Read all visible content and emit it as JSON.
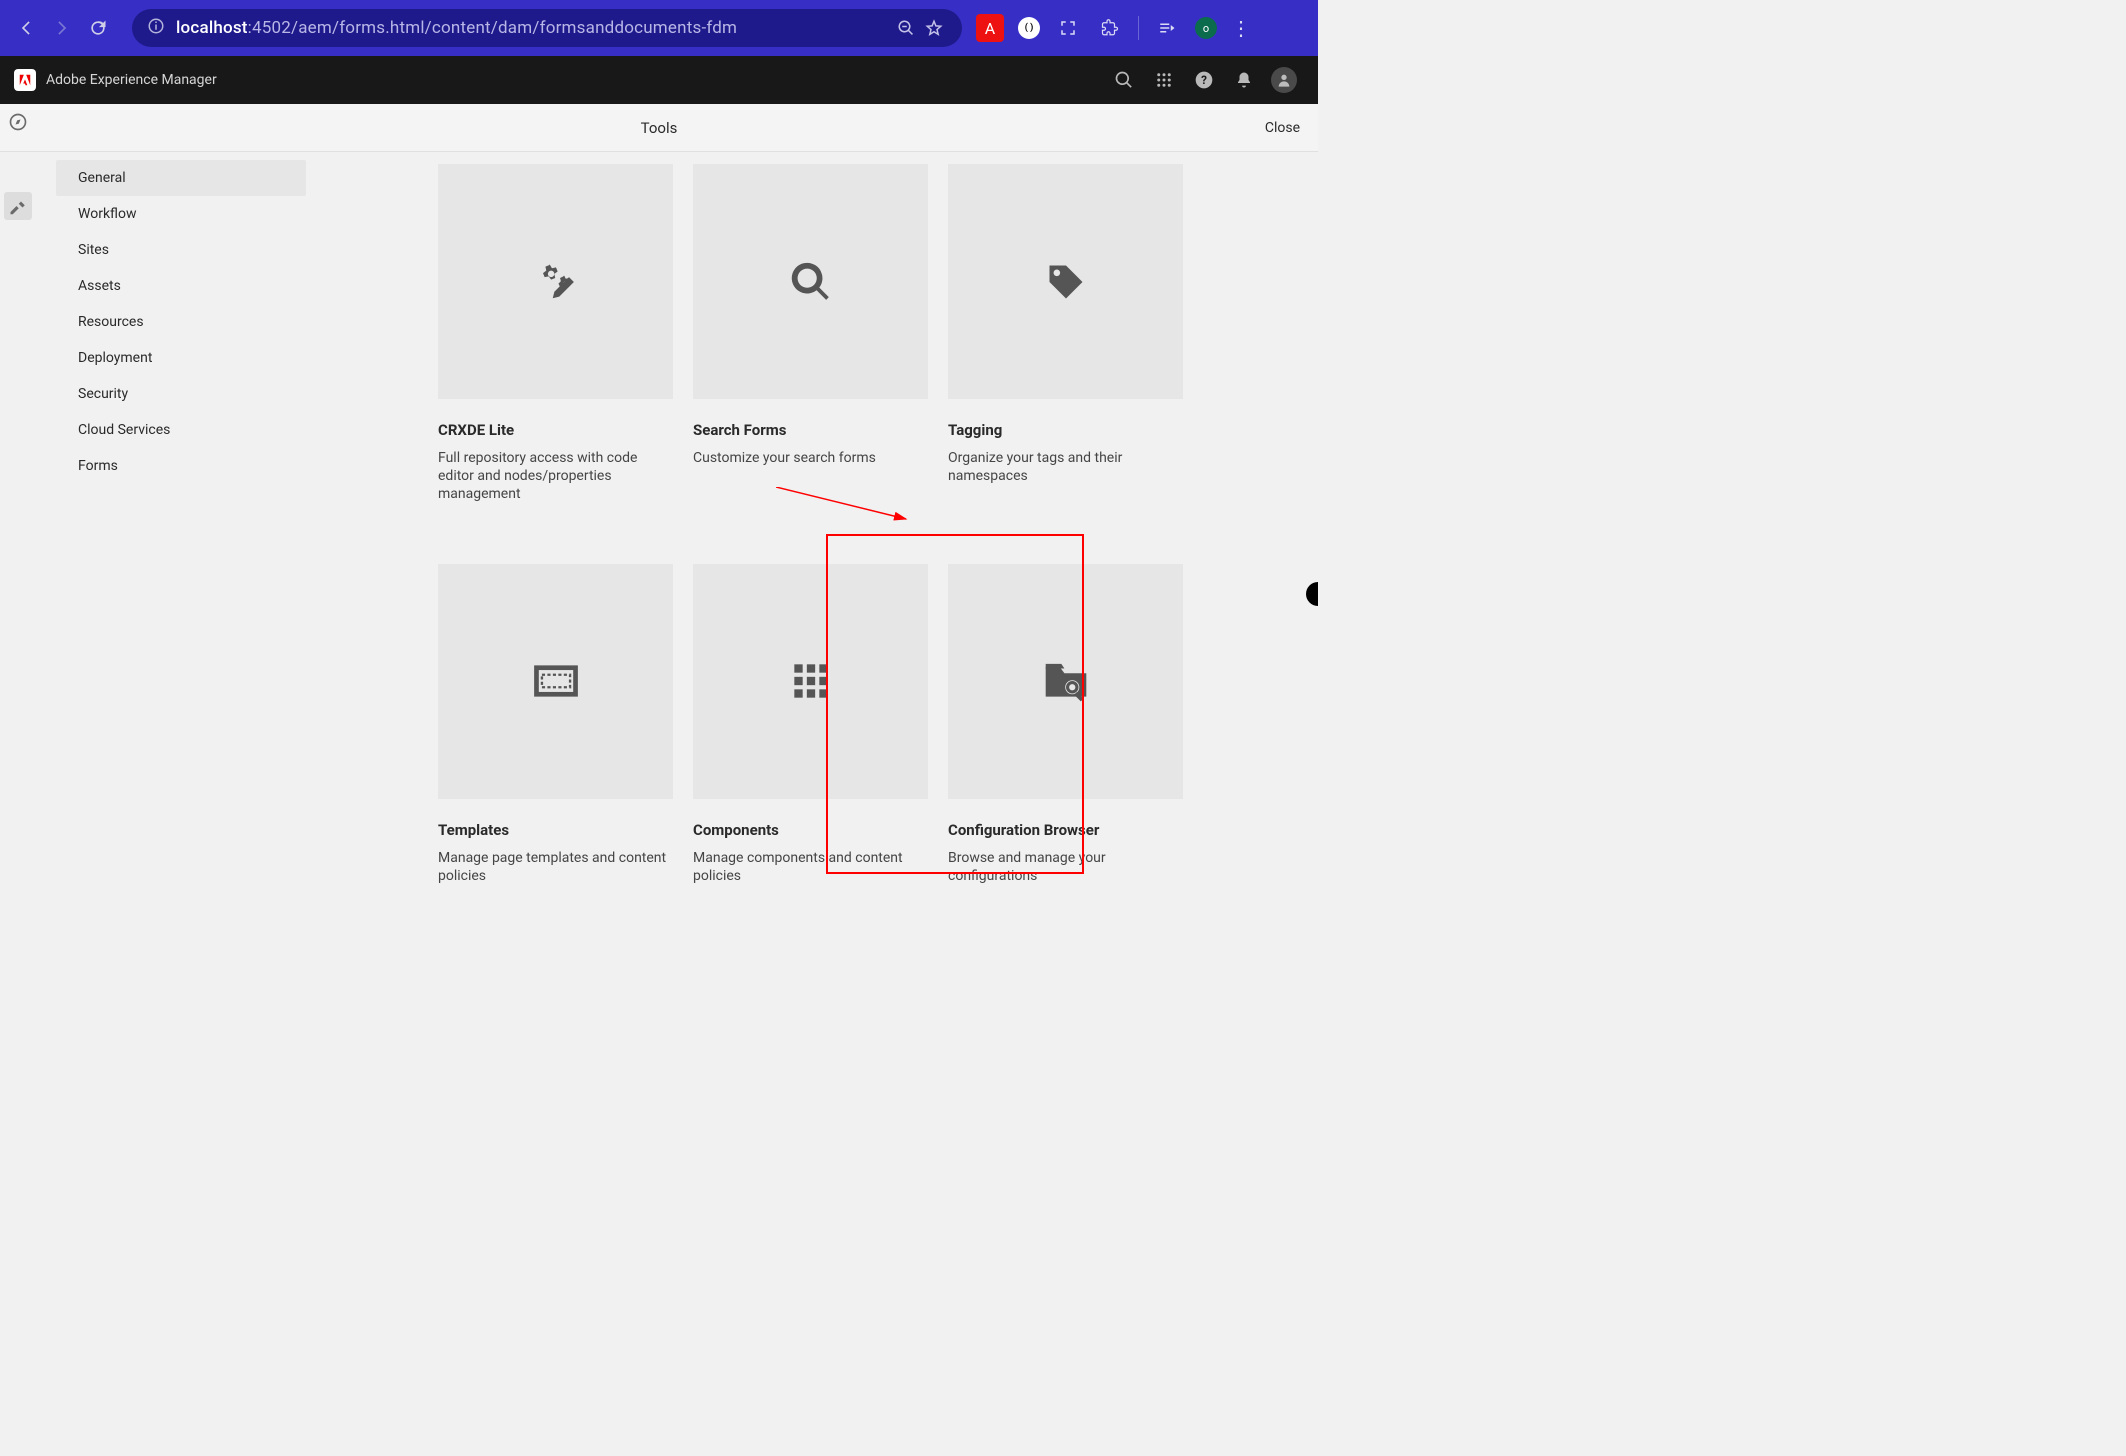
{
  "browser": {
    "url_host": "localhost",
    "url_rest": ":4502/aem/forms.html/content/dam/formsanddocuments-fdm",
    "avatar_letter": "o",
    "red_ext_letter": "A",
    "circle_ext_glyph": "( )"
  },
  "aem_header": {
    "product": "Adobe Experience Manager"
  },
  "tools_header": {
    "title": "Tools",
    "close": "Close"
  },
  "sidebar": {
    "items": [
      {
        "label": "General",
        "selected": true
      },
      {
        "label": "Workflow",
        "selected": false
      },
      {
        "label": "Sites",
        "selected": false
      },
      {
        "label": "Assets",
        "selected": false
      },
      {
        "label": "Resources",
        "selected": false
      },
      {
        "label": "Deployment",
        "selected": false
      },
      {
        "label": "Security",
        "selected": false
      },
      {
        "label": "Cloud Services",
        "selected": false
      },
      {
        "label": "Forms",
        "selected": false
      }
    ]
  },
  "cards": [
    {
      "icon": "gears-edit",
      "title": "CRXDE Lite",
      "desc": "Full repository access with code editor and nodes/properties management"
    },
    {
      "icon": "magnifier",
      "title": "Search Forms",
      "desc": "Customize your search forms"
    },
    {
      "icon": "tag",
      "title": "Tagging",
      "desc": "Organize your tags and their namespaces"
    },
    {
      "icon": "template-box",
      "title": "Templates",
      "desc": "Manage page templates and content policies"
    },
    {
      "icon": "grid",
      "title": "Components",
      "desc": "Manage components and content policies"
    },
    {
      "icon": "folder-search",
      "title": "Configuration Browser",
      "desc": "Browse and manage your configurations"
    }
  ]
}
